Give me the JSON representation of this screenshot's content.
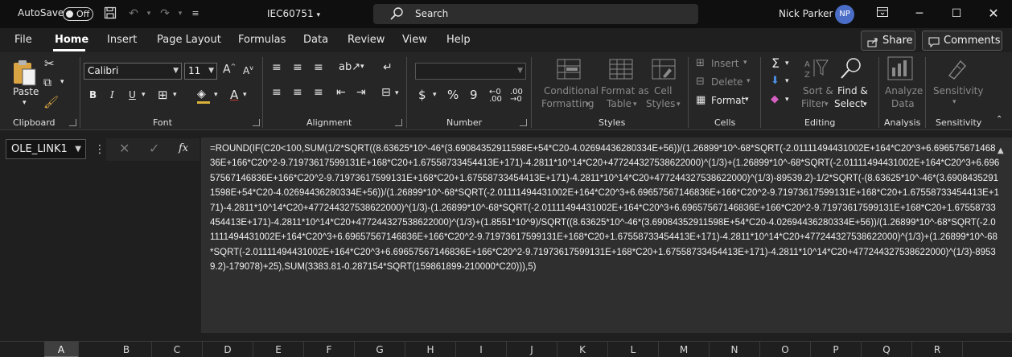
{
  "titlebar": {
    "autosave_label": "AutoSave",
    "autosave_state": "Off",
    "doc_title": "IEC60751",
    "search_label": "Search",
    "user_name": "Nick Parker",
    "user_initials": "NP"
  },
  "menu": {
    "tabs": [
      "File",
      "Home",
      "Insert",
      "Page Layout",
      "Formulas",
      "Data",
      "Review",
      "View",
      "Help"
    ],
    "active": "Home",
    "share_label": "Share",
    "comments_label": "Comments"
  },
  "ribbon": {
    "clipboard": {
      "paste": "Paste",
      "label": "Clipboard"
    },
    "font": {
      "family": "Calibri",
      "size": "11",
      "label": "Font"
    },
    "alignment": {
      "label": "Alignment"
    },
    "number": {
      "format": "",
      "label": "Number"
    },
    "styles": {
      "conditional_1": "Conditional",
      "conditional_2": "Formatting",
      "format_as_1": "Format as",
      "format_as_2": "Table",
      "cell_1": "Cell",
      "cell_2": "Styles",
      "label": "Styles"
    },
    "cells": {
      "insert": "Insert",
      "delete": "Delete",
      "format": "Format",
      "label": "Cells"
    },
    "editing": {
      "sort_1": "Sort &",
      "sort_2": "Filter",
      "find_1": "Find &",
      "find_2": "Select",
      "label": "Editing"
    },
    "analysis": {
      "analyze_1": "Analyze",
      "analyze_2": "Data",
      "label": "Analysis"
    },
    "sensitivity": {
      "btn": "Sensitivity",
      "label": "Sensitivity"
    }
  },
  "formula_bar": {
    "name_box": "OLE_LINK1",
    "fx": "fx",
    "formula": "=ROUND(IF(C20<100,SUM(1/2*SQRT((8.63625*10^-46*(3.69084352911598E+54*C20-4.02694436280334E+56))/(1.26899*10^-68*SQRT(-2.01111494431002E+164*C20^3+6.69657567146836E+166*C20^2-9.71973617599131E+168*C20+1.67558733454413E+171)-4.2811*10^14*C20+477244327538622000)^(1/3)+(1.26899*10^-68*SQRT(-2.01111494431002E+164*C20^3+6.69657567146836E+166*C20^2-9.71973617599131E+168*C20+1.67558733454413E+171)-4.2811*10^14*C20+477244327538622000)^(1/3)-89539.2)-1/2*SQRT(-(8.63625*10^-46*(3.69084352911598E+54*C20-4.02694436280334E+56))/(1.26899*10^-68*SQRT(-2.01111494431002E+164*C20^3+6.69657567146836E+166*C20^2-9.71973617599131E+168*C20+1.67558733454413E+171)-4.2811*10^14*C20+477244327538622000)^(1/3)-(1.26899*10^-68*SQRT(-2.01111494431002E+164*C20^3+6.69657567146836E+166*C20^2-9.71973617599131E+168*C20+1.67558733454413E+171)-4.2811*10^14*C20+477244327538622000)^(1/3)+(1.8551*10^9)/SQRT((8.63625*10^-46*(3.69084352911598E+54*C20-4.02694436280334E+56))/(1.26899*10^-68*SQRT(-2.01111494431002E+164*C20^3+6.69657567146836E+166*C20^2-9.71973617599131E+168*C20+1.67558733454413E+171)-4.2811*10^14*C20+477244327538622000)^(1/3)+(1.26899*10^-68*SQRT(-2.01111494431002E+164*C20^3+6.69657567146836E+166*C20^2-9.71973617599131E+168*C20+1.67558733454413E+171)-4.2811*10^14*C20+477244327538622000)^(1/3)-89539.2)-179078)+25),SUM(3383.81-0.287154*SQRT(159861899-210000*C20))),5)"
  },
  "columns": [
    "A",
    "B",
    "C",
    "D",
    "E",
    "F",
    "G",
    "H",
    "I",
    "J",
    "K",
    "L",
    "M",
    "N",
    "O",
    "P",
    "Q",
    "R"
  ],
  "selected_column": "A"
}
